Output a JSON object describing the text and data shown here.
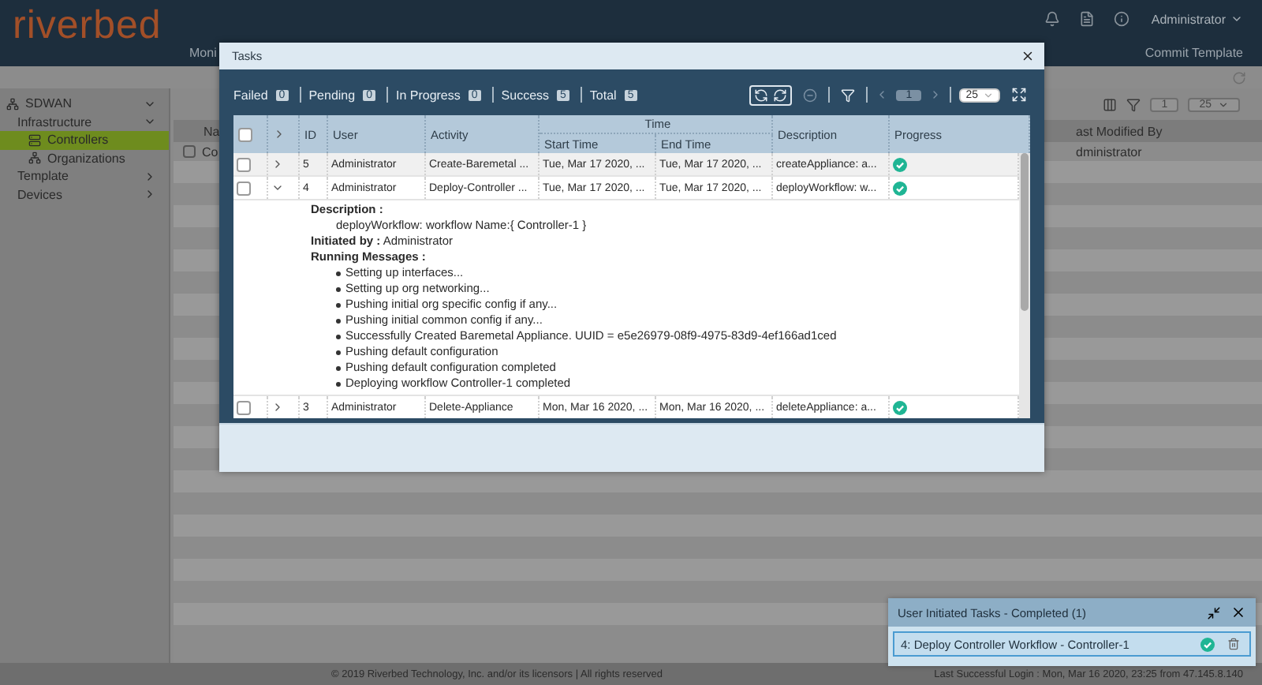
{
  "app_header": {
    "logo": "riverbed",
    "nav_left": "Moni",
    "nav_right": "Commit Template",
    "user": "Administrator"
  },
  "sidebar": {
    "items": [
      {
        "label": "SDWAN",
        "expanded": true,
        "selected": false,
        "children": [
          {
            "label": "Infrastructure",
            "expanded": true,
            "selected": false,
            "children": [
              {
                "label": "Controllers",
                "selected": true
              },
              {
                "label": "Organizations",
                "selected": false
              }
            ]
          }
        ]
      },
      {
        "label": "Template",
        "expanded": false,
        "selected": false
      },
      {
        "label": "Devices",
        "expanded": false,
        "selected": false
      }
    ]
  },
  "background_table": {
    "column_left": "Na",
    "row_left": "Co",
    "row_checked": false,
    "column_right": "ast Modified By",
    "row_right": "dministrator",
    "page": "1",
    "page_size": "25"
  },
  "tasks_dialog": {
    "title": "Tasks",
    "counts": [
      {
        "label": "Failed",
        "count": "0"
      },
      {
        "label": "Pending",
        "count": "0"
      },
      {
        "label": "In Progress",
        "count": "0"
      },
      {
        "label": "Success",
        "count": "5"
      },
      {
        "label": "Total",
        "count": "5"
      }
    ],
    "page": "1",
    "page_size": "25",
    "select_all_checked": false,
    "columns": {
      "id": "ID",
      "user": "User",
      "activity": "Activity",
      "time": "Time",
      "start": "Start Time",
      "end": "End Time",
      "description": "Description",
      "progress": "Progress"
    },
    "rows": [
      {
        "checked": false,
        "expanded": false,
        "id": "5",
        "user": "Administrator",
        "activity": "Create-Baremetal ...",
        "start": "Tue, Mar 17 2020, ...",
        "end": "Tue, Mar 17 2020, ...",
        "description": "createAppliance: a...",
        "completed": true
      },
      {
        "checked": false,
        "expanded": true,
        "id": "4",
        "user": "Administrator",
        "activity": "Deploy-Controller ...",
        "start": "Tue, Mar 17 2020, ...",
        "end": "Tue, Mar 17 2020, ...",
        "description": "deployWorkflow: w...",
        "completed": true,
        "details": {
          "description_label": "Description :",
          "description": "deployWorkflow: workflow Name:{ Controller-1 }",
          "initiated_label": "Initiated by :",
          "initiated_by": "Administrator",
          "messages_label": "Running Messages :",
          "messages": [
            "Setting up interfaces...",
            "Setting up org networking...",
            "Pushing initial org specific config if any...",
            "Pushing initial common config if any...",
            "Successfully Created Baremetal Appliance. UUID = e5e26979-08f9-4975-83d9-4ef166ad1ced",
            "Pushing default configuration",
            "Pushing default configuration completed",
            "Deploying workflow Controller-1 completed"
          ]
        }
      },
      {
        "checked": false,
        "expanded": false,
        "id": "3",
        "user": "Administrator",
        "activity": "Delete-Appliance",
        "start": "Mon, Mar 16 2020, ...",
        "end": "Mon, Mar 16 2020, ...",
        "description": "deleteAppliance: a...",
        "completed": true
      }
    ]
  },
  "toast": {
    "title": "User Initiated Tasks - Completed (1)",
    "items": [
      {
        "label": "4: Deploy Controller Workflow - Controller-1",
        "completed": true
      }
    ]
  },
  "footer": {
    "copyright": "© 2019 Riverbed Technology, Inc. and/or its licensors | All rights reserved",
    "last_login": "Last Successful Login : Mon, Mar 16 2020, 23:25 from 47.145.8.140"
  }
}
